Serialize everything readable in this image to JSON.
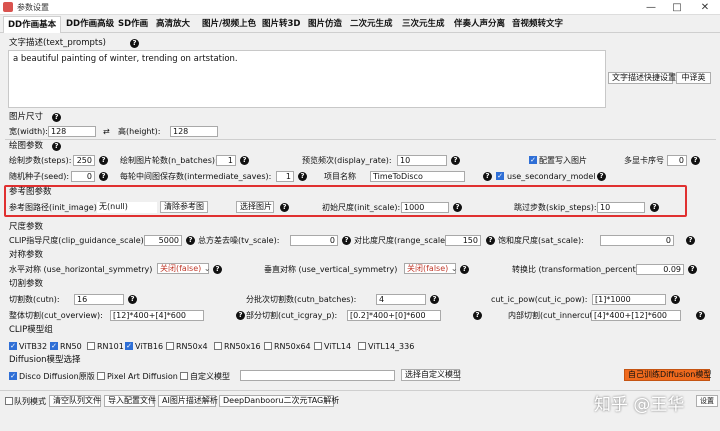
{
  "window": {
    "title": "参数设置",
    "min": "—",
    "max": "□",
    "close": "✕"
  },
  "tabs": [
    "DD作画基本",
    "DD作画高级",
    "SD作画",
    "高清放大",
    "图片/视频上色",
    "图片转3D",
    "图片仿造",
    "二次元生成",
    "三次元生成",
    "伴奏人声分离",
    "音视频转文字"
  ],
  "help": "?",
  "text_prompts": {
    "label": "文字描述(text_prompts)",
    "value": "a beautiful painting of winter, trending on artstation.",
    "btn_shortcut": "文字描述快捷设置",
    "btn_translate": "中译英"
  },
  "size": {
    "section": "图片尺寸",
    "width_label": "宽(width):",
    "width": "128",
    "swap": "⇄",
    "height_label": "高(height):",
    "height": "128"
  },
  "draw": {
    "section": "绘图参数",
    "steps_label": "绘制步数(steps):",
    "steps": "250",
    "batches_label": "绘制图片轮数(n_batches):",
    "batches": "1",
    "display_rate_label": "预览频次(display_rate):",
    "display_rate": "10",
    "write_config_label": "配置写入图片",
    "card_label": "多显卡序号",
    "card": "0",
    "seed_label": "随机种子(seed):",
    "seed": "0",
    "saves_label": "每轮中间图保存数(intermediate_saves):",
    "saves": "1",
    "project_label": "项目名称",
    "project": "TimeToDisco",
    "secondary_label": "use_secondary_model"
  },
  "ref": {
    "section": "参考图参数",
    "init_image_label": "参考图路径(init_image):",
    "init_image": "无(null)",
    "clear_btn": "清除参考图",
    "select_btn": "选择图片",
    "init_scale_label": "初始尺度(init_scale):",
    "init_scale": "1000",
    "skip_label": "跳过步数(skip_steps):",
    "skip": "10"
  },
  "scale": {
    "section": "尺度参数",
    "clip_label": "CLIP指导尺度(clip_guidance_scale):",
    "clip": "5000",
    "tv_label": "总方差去噪(tv_scale):",
    "tv": "0",
    "range_label": "对比度尺度(range_scale):",
    "range": "150",
    "sat_label": "饱和度尺度(sat_scale):",
    "sat": "0"
  },
  "sym": {
    "section": "对称参数",
    "h_label": "水平对称 (use_horizontal_symmetry)",
    "h": "关闭(false)",
    "v_label": "垂直对称 (use_vertical_symmetry)",
    "v": "关闭(false)",
    "tp_label": "转换比 (transformation_percent)",
    "tp": "0.09",
    "arrow": "⌄"
  },
  "cut": {
    "section": "切割参数",
    "cutn_label": "切割数(cutn):",
    "cutn": "16",
    "batches_label": "分批次切割数(cutn_batches):",
    "batches": "4",
    "pow_label": "cut_ic_pow(cut_ic_pow):",
    "pow": "[1]*1000",
    "overview_label": "整体切割(cut_overview):",
    "overview": "[12]*400+[4]*600",
    "icgray_label": "部分切割(cut_icgray_p):",
    "icgray": "[0.2]*400+[0]*600",
    "innercut_label": "内部切割(cut_innercut):",
    "innercut": "[4]*400+[12]*600"
  },
  "clip_models": {
    "section": "CLIP模型组",
    "items": [
      {
        "name": "ViTB32",
        "on": true
      },
      {
        "name": "RN50",
        "on": true
      },
      {
        "name": "RN101",
        "on": false
      },
      {
        "name": "ViTB16",
        "on": true
      },
      {
        "name": "RN50x4",
        "on": false
      },
      {
        "name": "RN50x16",
        "on": false
      },
      {
        "name": "RN50x64",
        "on": false
      },
      {
        "name": "ViTL14",
        "on": false
      },
      {
        "name": "ViTL14_336",
        "on": false
      }
    ]
  },
  "diff": {
    "section": "Diffusion模型选择",
    "disco": "Disco Diffusion原版",
    "pixel": "Pixel Art Diffusion",
    "custom": "自定义模型",
    "choose_btn": "选择自定义模型",
    "train_btn": "自己训练Diffusion模型"
  },
  "bottom": {
    "queue": "队列模式",
    "clear_queue": "清空队列文件",
    "import": "导入配置文件",
    "ai_desc": "AI图片描述解析",
    "deepdan": "DeepDanbooru二次元TAG解析",
    "watermark": "知乎 @王华",
    "settings": "设置"
  },
  "colors": {
    "highlight": "#e03030",
    "checkbox": "#2f6fd6",
    "train_btn": "#f06a1d"
  }
}
